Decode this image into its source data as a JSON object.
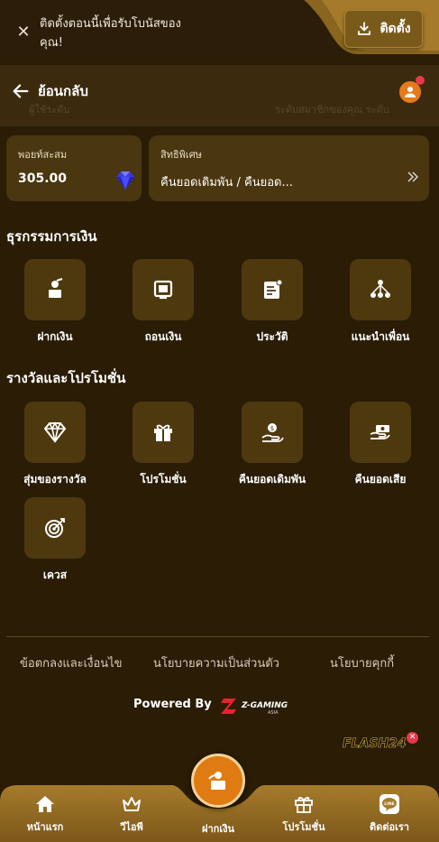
{
  "install_banner": {
    "message": "ติดตั้งตอนนี้เพื่อรับโบนัสของคุณ!",
    "install_label": "ติดตั้ง"
  },
  "header": {
    "back_label": "ย้อนกลับ",
    "ghost_left": "ผู้ใช้ระดับ",
    "ghost_right": "ระดับสมาชิกของคุณ ระดับ"
  },
  "points_card": {
    "label": "พอยท์สะสม",
    "value": "305.00"
  },
  "privilege_card": {
    "label": "สิทธิพิเศษ",
    "value": "คืนยอดเดิมพัน / คืนยอด..."
  },
  "finance_section": {
    "title": "ธุรกรรมการเงิน",
    "items": [
      {
        "label": "ฝากเงิน",
        "icon": "deposit-icon"
      },
      {
        "label": "ถอนเงิน",
        "icon": "withdraw-icon"
      },
      {
        "label": "ประวัติ",
        "icon": "history-icon"
      },
      {
        "label": "แนะนำเพื่อน",
        "icon": "referral-icon"
      }
    ]
  },
  "rewards_section": {
    "title": "รางวัลและโปรโมชั่น",
    "items": [
      {
        "label": "สุ่มของรางวัล",
        "icon": "diamond-icon"
      },
      {
        "label": "โปรโมชั่น",
        "icon": "gift-icon"
      },
      {
        "label": "คืนยอดเดิมพัน",
        "icon": "coin-hand-icon"
      },
      {
        "label": "คืนยอดเสีย",
        "icon": "cash-hand-icon"
      },
      {
        "label": "เควส",
        "icon": "target-icon"
      }
    ]
  },
  "footer": {
    "links": [
      "ข้อตกลงและเงื่อนไข",
      "นโยบายความเป็นส่วนตัว",
      "นโยบายคุกกี้"
    ],
    "powered_by": "Powered By",
    "provider_logo_text": "Z-GAMING",
    "provider_logo_sub": "ASIA",
    "flash_logo_text": "FLASH24"
  },
  "bottom_nav": {
    "items": [
      {
        "label": "หน้าแรก",
        "icon": "home-icon"
      },
      {
        "label": "วีไอพี",
        "icon": "crown-icon"
      },
      {
        "label": "ฝากเงิน",
        "icon": "deposit-icon"
      },
      {
        "label": "โปรโมชั่น",
        "icon": "gift-icon"
      },
      {
        "label": "ติดต่อเรา",
        "icon": "line-icon"
      }
    ]
  },
  "colors": {
    "background": "#2a1c05",
    "card": "#4a360f",
    "accent_orange": "#e07a12",
    "nav_gold": "#9a7126",
    "notification_red": "#e8394a"
  }
}
